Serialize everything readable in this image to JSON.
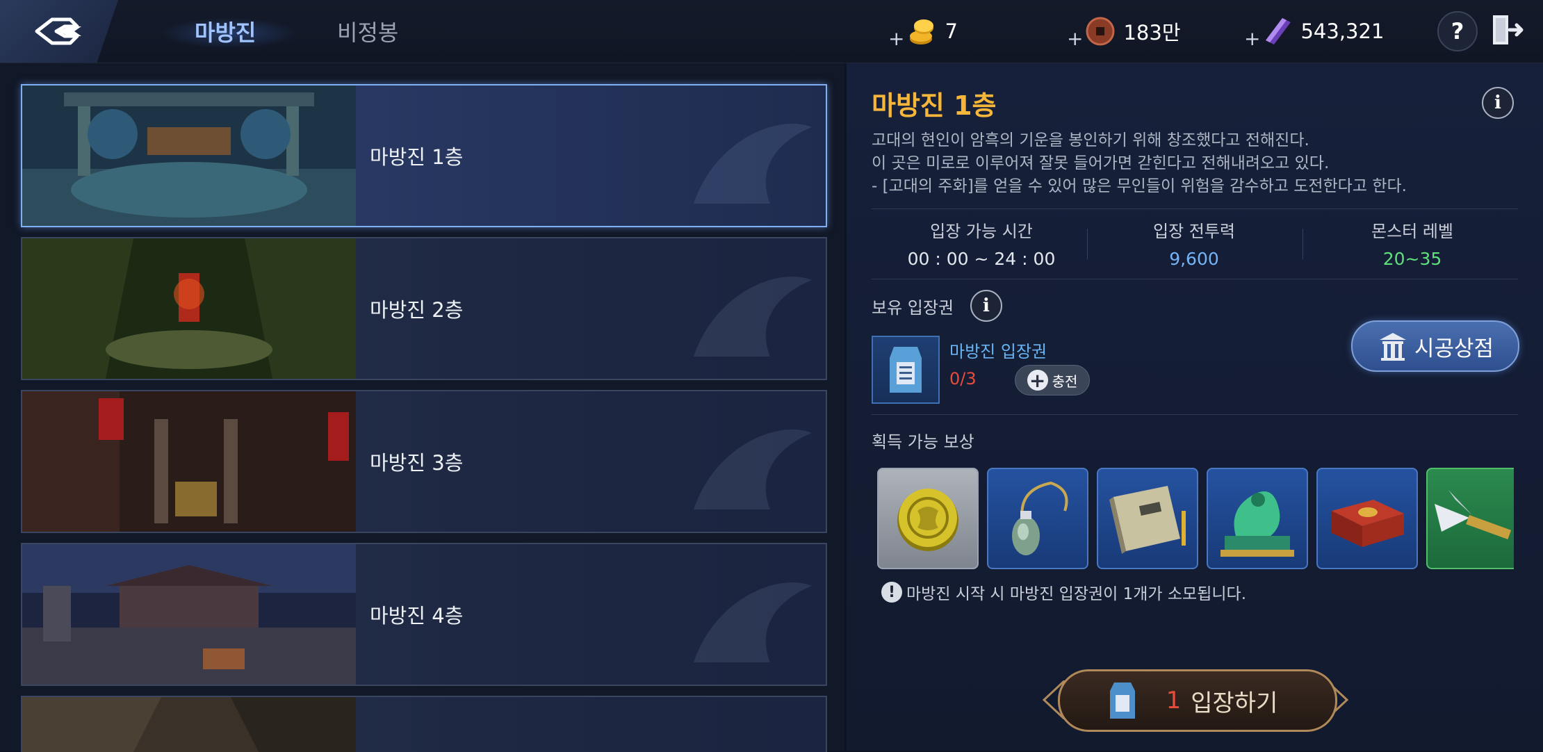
{
  "topbar": {
    "tabs": [
      {
        "label": "마방진",
        "active": true
      },
      {
        "label": "비정봉",
        "active": false
      }
    ],
    "currencies": [
      {
        "icon": "gold-coins-icon",
        "plus": "+",
        "value": "7"
      },
      {
        "icon": "copper-coin-icon",
        "plus": "+",
        "value": "183만"
      },
      {
        "icon": "purple-crystal-icon",
        "plus": "+",
        "value": "543,321"
      }
    ],
    "help_label": "?"
  },
  "dungeons": [
    {
      "label": "마방진 1층",
      "selected": true
    },
    {
      "label": "마방진 2층",
      "selected": false
    },
    {
      "label": "마방진 3층",
      "selected": false
    },
    {
      "label": "마방진 4층",
      "selected": false
    },
    {
      "label": "",
      "selected": false
    }
  ],
  "detail": {
    "title": "마방진 1층",
    "info_label": "i",
    "description": [
      "고대의 현인이 암흑의 기운을 봉인하기 위해 창조했다고 전해진다.",
      "이 곳은 미로로 이루어져 잘못 들어가면 갇힌다고 전해내려오고 있다.",
      "- [고대의 주화]를 얻을 수 있어 많은 무인들이 위험을 감수하고 도전한다고 한다."
    ],
    "stats": [
      {
        "label": "입장 가능 시간",
        "value": "00 : 00 ~ 24 : 00",
        "color": "#e4e7ee"
      },
      {
        "label": "입장 전투력",
        "value": "9,600",
        "color": "#74b4f7"
      },
      {
        "label": "몬스터 레벨",
        "value": "20~35",
        "color": "#5fe07a"
      }
    ],
    "owned_ticket_label": "보유 입장권",
    "ticket": {
      "name": "마방진 입장권",
      "count": "0/3",
      "charge_label": "충전"
    },
    "shop_label": "시공상점",
    "rewards_label": "획득 가능 보상",
    "rewards": [
      {
        "icon": "ancient-coin-icon"
      },
      {
        "icon": "jade-pendant-icon"
      },
      {
        "icon": "skill-book-icon"
      },
      {
        "icon": "jade-dragon-seal-icon"
      },
      {
        "icon": "red-chest-icon"
      },
      {
        "icon": "spear-weapon-icon"
      }
    ],
    "warning": "마방진 시작 시 마방진 입장권이 1개가 소모됩니다.",
    "enter": {
      "count": "1",
      "label": "입장하기"
    }
  }
}
